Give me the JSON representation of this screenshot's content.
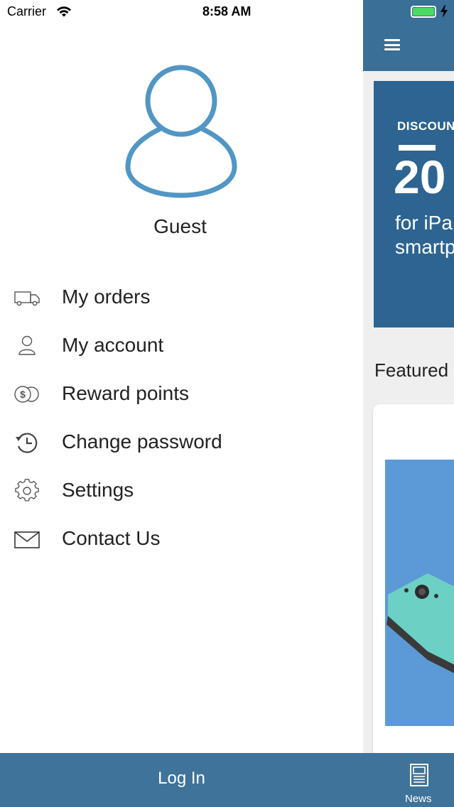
{
  "status_bar": {
    "carrier": "Carrier",
    "time": "8:58 AM"
  },
  "drawer": {
    "username": "Guest",
    "menu": [
      {
        "label": "My orders",
        "icon": "truck-icon"
      },
      {
        "label": "My account",
        "icon": "user-icon"
      },
      {
        "label": "Reward points",
        "icon": "coins-icon"
      },
      {
        "label": "Change password",
        "icon": "history-icon"
      },
      {
        "label": "Settings",
        "icon": "gear-icon"
      },
      {
        "label": "Contact Us",
        "icon": "envelope-icon"
      }
    ],
    "login_label": "Log In"
  },
  "background_app": {
    "banner": {
      "title": "DISCOUN",
      "big": "20",
      "line1": "for iPa",
      "line2": "smartp"
    },
    "featured_label": "Featured",
    "tabbar": {
      "news_label": "News"
    }
  },
  "colors": {
    "brand": "#3f7399",
    "avatar_stroke": "#5196c4",
    "banner": "#2d6491",
    "battery": "#4cd964"
  }
}
